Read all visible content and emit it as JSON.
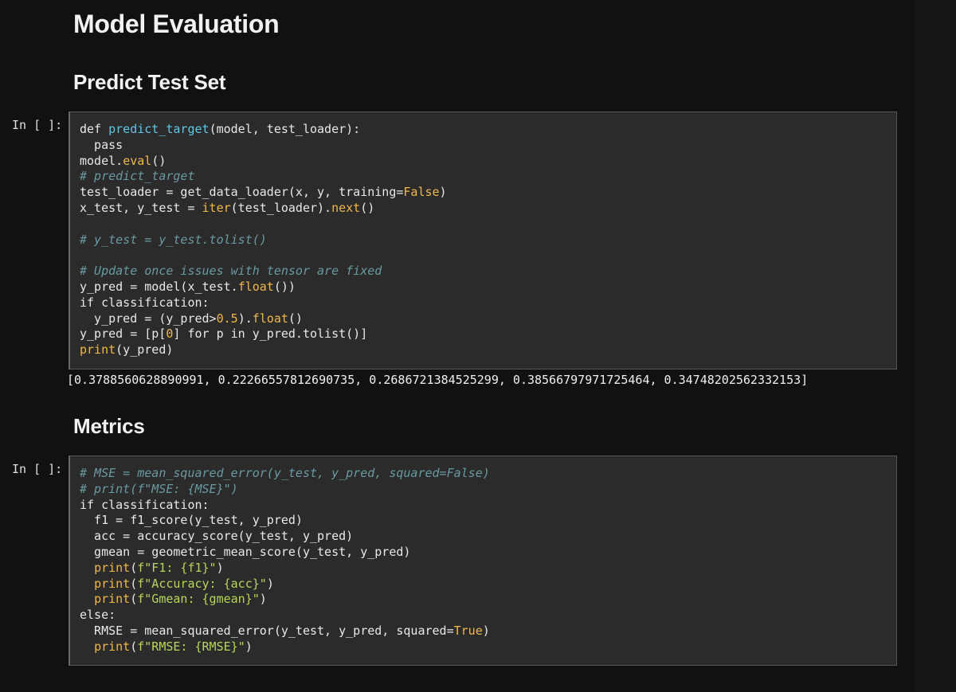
{
  "headings": {
    "model_evaluation": "Model Evaluation",
    "predict_test_set": "Predict Test Set",
    "metrics": "Metrics"
  },
  "cells": [
    {
      "prompt": "In [ ]:",
      "lines": [
        [
          [
            "kw",
            "def "
          ],
          [
            "fn",
            "predict_target"
          ],
          [
            "kw",
            "(model, test_loader):"
          ]
        ],
        [
          [
            "kw",
            "  pass"
          ]
        ],
        [
          [
            "kw",
            "model."
          ],
          [
            "attr",
            "eval"
          ],
          [
            "kw",
            "()"
          ]
        ],
        [
          [
            "cm",
            "# predict_target"
          ]
        ],
        [
          [
            "kw",
            "test_loader = get_data_loader(x, y, training="
          ],
          [
            "bool",
            "False"
          ],
          [
            "kw",
            ")"
          ]
        ],
        [
          [
            "kw",
            "x_test, y_test = "
          ],
          [
            "attr",
            "iter"
          ],
          [
            "kw",
            "(test_loader)."
          ],
          [
            "attr",
            "next"
          ],
          [
            "kw",
            "()"
          ]
        ],
        [
          [
            "kw",
            ""
          ]
        ],
        [
          [
            "cm",
            "# y_test = y_test.tolist()"
          ]
        ],
        [
          [
            "kw",
            ""
          ]
        ],
        [
          [
            "cm",
            "# Update once issues with tensor are fixed"
          ]
        ],
        [
          [
            "kw",
            "y_pred = model(x_test."
          ],
          [
            "attr",
            "float"
          ],
          [
            "kw",
            "())"
          ]
        ],
        [
          [
            "kw",
            "if classification:"
          ]
        ],
        [
          [
            "kw",
            "  y_pred = (y_pred>"
          ],
          [
            "num",
            "0.5"
          ],
          [
            "kw",
            ")."
          ],
          [
            "attr",
            "float"
          ],
          [
            "kw",
            "()"
          ]
        ],
        [
          [
            "kw",
            "y_pred = [p["
          ],
          [
            "num",
            "0"
          ],
          [
            "kw",
            "] for p in y_pred.tolist()]"
          ]
        ],
        [
          [
            "pr",
            "print"
          ],
          [
            "kw",
            "(y_pred)"
          ]
        ]
      ],
      "output": "[0.3788560628890991, 0.22266557812690735, 0.2686721384525299, 0.38566797971725464, 0.34748202562332153]"
    },
    {
      "prompt": "In [ ]:",
      "lines": [
        [
          [
            "cm",
            "# MSE = mean_squared_error(y_test, y_pred, squared=False)"
          ]
        ],
        [
          [
            "cm",
            "# print(f\"MSE: {MSE}\")"
          ]
        ],
        [
          [
            "kw",
            "if classification:"
          ]
        ],
        [
          [
            "kw",
            "  f1 = f1_score(y_test, y_pred)"
          ]
        ],
        [
          [
            "kw",
            "  acc = accuracy_score(y_test, y_pred)"
          ]
        ],
        [
          [
            "kw",
            "  gmean = geometric_mean_score(y_test, y_pred)"
          ]
        ],
        [
          [
            "kw",
            "  "
          ],
          [
            "pr",
            "print"
          ],
          [
            "kw",
            "("
          ],
          [
            "str",
            "f\"F1: {f1}\""
          ],
          [
            "kw",
            ")"
          ]
        ],
        [
          [
            "kw",
            "  "
          ],
          [
            "pr",
            "print"
          ],
          [
            "kw",
            "("
          ],
          [
            "str",
            "f\"Accuracy: {acc}\""
          ],
          [
            "kw",
            ")"
          ]
        ],
        [
          [
            "kw",
            "  "
          ],
          [
            "pr",
            "print"
          ],
          [
            "kw",
            "("
          ],
          [
            "str",
            "f\"Gmean: {gmean}\""
          ],
          [
            "kw",
            ")"
          ]
        ],
        [
          [
            "kw",
            "else:"
          ]
        ],
        [
          [
            "kw",
            "  RMSE = mean_squared_error(y_test, y_pred, squared="
          ],
          [
            "bool",
            "True"
          ],
          [
            "kw",
            ")"
          ]
        ],
        [
          [
            "kw",
            "  "
          ],
          [
            "pr",
            "print"
          ],
          [
            "kw",
            "("
          ],
          [
            "str",
            "f\"RMSE: {RMSE}\""
          ],
          [
            "kw",
            ")"
          ]
        ]
      ]
    }
  ]
}
